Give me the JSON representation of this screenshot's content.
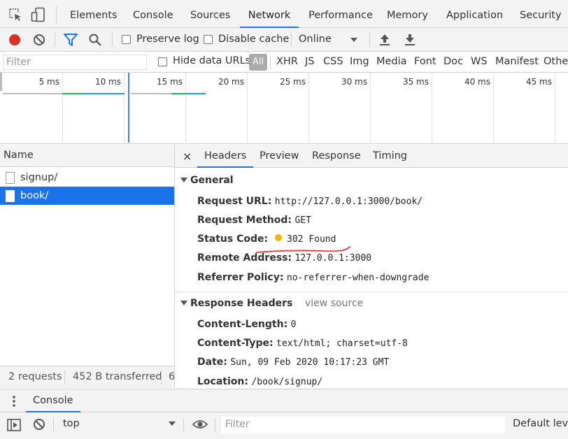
{
  "tabs": {
    "items": [
      "Elements",
      "Console",
      "Sources",
      "Network",
      "Performance",
      "Memory",
      "Application",
      "Security"
    ],
    "selected": "Network"
  },
  "toolbar": {
    "preserve_log": "Preserve log",
    "disable_cache": "Disable cache",
    "throttling": "Online"
  },
  "filter": {
    "placeholder": "Filter",
    "hide_data_urls": "Hide data URLs",
    "types": [
      "All",
      "XHR",
      "JS",
      "CSS",
      "Img",
      "Media",
      "Font",
      "Doc",
      "WS",
      "Manifest",
      "Othe"
    ]
  },
  "overview": {
    "ticks": [
      "5 ms",
      "10 ms",
      "15 ms",
      "20 ms",
      "25 ms",
      "30 ms",
      "35 ms",
      "40 ms",
      "45 ms"
    ]
  },
  "requests": {
    "header": "Name",
    "rows": [
      "signup/",
      "book/"
    ],
    "selected": "book/",
    "status_count": "2 requests",
    "status_transferred": "452 B transferred",
    "status_more": "6"
  },
  "details": {
    "tabs": [
      "Headers",
      "Preview",
      "Response",
      "Timing"
    ],
    "selected_tab": "Headers",
    "close": "×",
    "general": {
      "title": "General",
      "request_url_label": "Request URL:",
      "request_url": "http://127.0.0.1:3000/book/",
      "method_label": "Request Method:",
      "method": "GET",
      "status_label": "Status Code:",
      "status": "302 Found",
      "remote_label": "Remote Address:",
      "remote": "127.0.0.1:3000",
      "referrer_label": "Referrer Policy:",
      "referrer": "no-referrer-when-downgrade"
    },
    "response_headers": {
      "title": "Response Headers",
      "view_source": "view source",
      "content_length_label": "Content-Length:",
      "content_length": "0",
      "content_type_label": "Content-Type:",
      "content_type": "text/html; charset=utf-8",
      "date_label": "Date:",
      "date": "Sun, 09 Feb 2020 10:17:23 GMT",
      "location_label": "Location:",
      "location": "/book/signup/"
    }
  },
  "drawer": {
    "tab": "Console",
    "context": "top",
    "filter_placeholder": "Filter",
    "levels": "Default leve"
  },
  "colors": {
    "accent": "#1a73e8",
    "record": "#d93025",
    "status_dot": "#f5b400",
    "annotation": "#e53935"
  }
}
